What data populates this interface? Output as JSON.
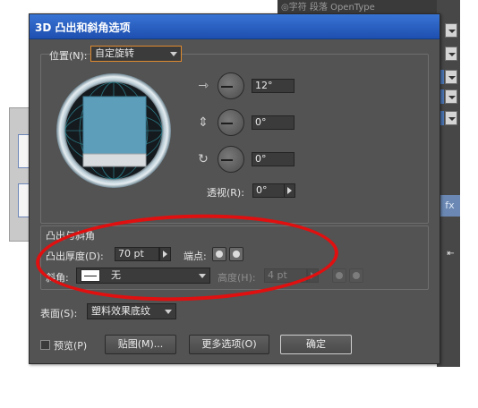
{
  "background": {
    "panel_header": "◎字符  段落  OpenType",
    "side_tab_glyph": "fx",
    "side_tab_glyph2": "⇤"
  },
  "dialog": {
    "title": "3D 凸出和斜角选项",
    "position": {
      "label": "位置(N):",
      "preset": "自定旋转",
      "rotation_x": "12°",
      "rotation_y": "0°",
      "rotation_z": "0°",
      "perspective_label": "透视(R):",
      "perspective_value": "0°"
    },
    "extrude_bevel": {
      "group_label": "凸出与斜角",
      "depth_label": "凸出厚度(D):",
      "depth_value": "70 pt",
      "cap_label": "端点:",
      "bevel_label": "斜角:",
      "bevel_value": "无",
      "height_label": "高度(H):",
      "height_value": "4 pt"
    },
    "surface": {
      "label": "表面(S):",
      "value": "塑料效果底纹"
    },
    "footer": {
      "preview_label": "预览(P)",
      "map_button": "贴图(M)...",
      "more_button": "更多选项(O)",
      "ok_button": "确定"
    }
  },
  "colors": {
    "titlebar": "#2a62c4",
    "dialog_bg": "#535353",
    "cube_face": "#5d9fbb",
    "annotation": "#e01010"
  }
}
